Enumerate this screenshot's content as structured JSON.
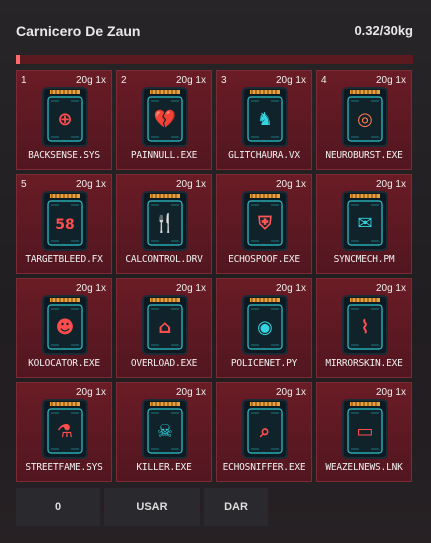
{
  "header": {
    "title": "Carnicero De Zaun",
    "weight": "0.32/30kg",
    "weight_fraction": 0.0107
  },
  "slots": [
    {
      "number": "1",
      "meta": "20g 1x",
      "label": "BACKSENSE.SYS",
      "icon": "target-person-icon",
      "glyph": "⊕",
      "glyph_color": "#ff4d4d"
    },
    {
      "number": "2",
      "meta": "20g 1x",
      "label": "PAINNULL.EXE",
      "icon": "broken-heart-icon",
      "glyph": "💔",
      "glyph_color": "#ff6b6b"
    },
    {
      "number": "3",
      "meta": "20g 1x",
      "label": "GLITCHAURA.VX",
      "icon": "horse-head-icon",
      "glyph": "♞",
      "glyph_color": "#33d6e0"
    },
    {
      "number": "4",
      "meta": "20g 1x",
      "label": "NEUROBURST.EXE",
      "icon": "burst-skull-icon",
      "glyph": "◎",
      "glyph_color": "#ff7a4d"
    },
    {
      "number": "5",
      "meta": "20g 1x",
      "label": "TARGETBLEED.FX",
      "icon": "damage-58-icon",
      "glyph": "58",
      "glyph_color": "#ff4d4d"
    },
    {
      "number": "",
      "meta": "20g 1x",
      "label": "CALCONTROL.DRV",
      "icon": "fork-knife-icon",
      "glyph": "🍴",
      "glyph_color": "#33d6e0"
    },
    {
      "number": "",
      "meta": "20g 1x",
      "label": "ECHOSPOOF.EXE",
      "icon": "shield-person-icon",
      "glyph": "⛨",
      "glyph_color": "#ff5555"
    },
    {
      "number": "",
      "meta": "20g 1x",
      "label": "SYNCMECH.PM",
      "icon": "envelope-icon",
      "glyph": "✉",
      "glyph_color": "#33d6e0"
    },
    {
      "number": "",
      "meta": "20g 1x",
      "label": "KOLOCATOR.EXE",
      "icon": "person-camera-icon",
      "glyph": "☻",
      "glyph_color": "#ff4d4d"
    },
    {
      "number": "",
      "meta": "20g 1x",
      "label": "OVERLOAD.EXE",
      "icon": "basket-icon",
      "glyph": "⌂",
      "glyph_color": "#ff4d4d"
    },
    {
      "number": "",
      "meta": "20g 1x",
      "label": "POLICENET.PY",
      "icon": "cctv-camera-icon",
      "glyph": "◉",
      "glyph_color": "#33d6e0"
    },
    {
      "number": "",
      "meta": "20g 1x",
      "label": "MIRRORSKIN.EXE",
      "icon": "dna-icon",
      "glyph": "⌇",
      "glyph_color": "#ff4d4d"
    },
    {
      "number": "",
      "meta": "20g 1x",
      "label": "STREETFAME.SYS",
      "icon": "chemistry-flask-icon",
      "glyph": "⚗",
      "glyph_color": "#ff4d4d"
    },
    {
      "number": "",
      "meta": "20g 1x",
      "label": "KILLER.EXE",
      "icon": "skull-icon",
      "glyph": "☠",
      "glyph_color": "#33d6e0"
    },
    {
      "number": "",
      "meta": "20g 1x",
      "label": "ECHOSNIFFER.EXE",
      "icon": "magnifier-icon",
      "glyph": "⌕",
      "glyph_color": "#ff4d4d"
    },
    {
      "number": "",
      "meta": "20g 1x",
      "label": "WEAZELNEWS.LNK",
      "icon": "id-card-icon",
      "glyph": "▭",
      "glyph_color": "#ff4d4d"
    }
  ],
  "buttons": {
    "zero": "0",
    "use": "USAR",
    "give": "DAR"
  },
  "colors": {
    "accent": "#33d6e0",
    "bar_fill": "#ff6b6b",
    "slot_bg": "#6a1c25"
  }
}
